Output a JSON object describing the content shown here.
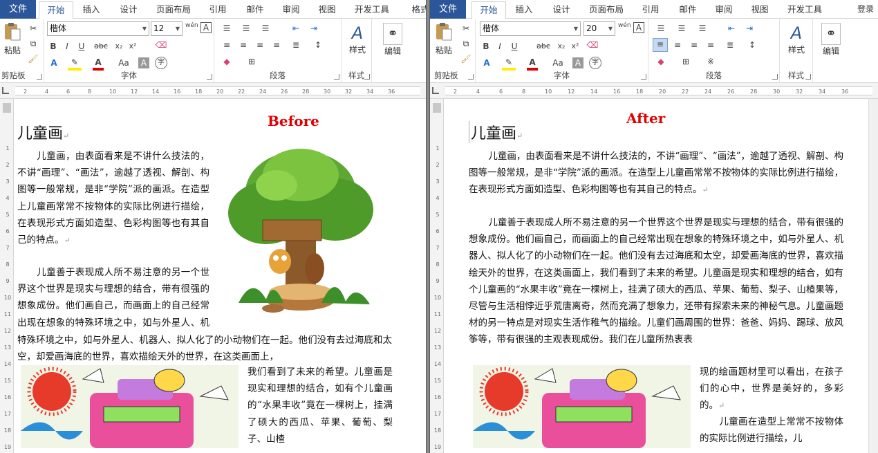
{
  "ribbon": {
    "file_tab": "文件",
    "tabs": [
      "开始",
      "插入",
      "设计",
      "页面布局",
      "引用",
      "邮件",
      "审阅",
      "视图",
      "开发工具",
      "格式"
    ],
    "login": "登录",
    "clipboard": {
      "paste": "粘贴",
      "group": "剪贴板"
    },
    "font": {
      "group": "字体",
      "strike": "abc",
      "sub": "x₂",
      "sup": "x²",
      "wen": "wén",
      "A": "A",
      "case": "Aa",
      "char": "字"
    },
    "paragraph": {
      "group": "段落"
    },
    "styles": {
      "label": "样式",
      "group": "样式"
    },
    "editing": {
      "label": "编辑"
    }
  },
  "left": {
    "font_name": "楷体",
    "font_size": "12",
    "label": "Before",
    "title": "儿童画",
    "p1": "儿童画，由表面看来是不讲什么技法的，不讲“画理”、“画法”，逾越了透视、解剖、构图等一般常规，是非“学院”派的画派。在造型上儿童画常常不按物体的实际比例进行描绘，在表现形式方面如造型、色彩构图等也有其自己的特点。",
    "p2": "儿童善于表现成人所不易注意的另一个世界这个世界是现实与理想的结合，带有很强的想象成份。他们画自己，而画面上的自己经常出现在想象的特殊环境之中，如与外星人、机器人、拟人化了的小动物们在一起。他们没有去过海底和太空，却爱画海底的世界，喜欢描绘天外的世界，在这类画面上，",
    "p3": "我们看到了未来的希望。儿童画是现实和理想的结合，如有个儿童画的“水果丰收”竟在一棵树上，挂满了硕大的西瓜、苹果、葡萄、梨子、山楂"
  },
  "right": {
    "font_name": "楷体",
    "font_size": "20",
    "label": "After",
    "title": "儿童画",
    "p1": "儿童画，由表面看来是不讲什么技法的，不讲“画理”、“画法”，逾越了透视、解剖、构图等一般常规，是非“学院”派的画派。在造型上儿童画常常不按物体的实际比例进行描绘，在表现形式方面如造型、色彩构图等也有其自己的特点。",
    "p2": "儿童善于表现成人所不易注意的另一个世界这个世界是现实与理想的结合，带有很强的想象成份。他们画自己，而画面上的自己经常出现在想象的特殊环境之中，如与外星人、机器人、拟人化了的小动物们在一起。他们没有去过海底和太空，却爱画海底的世界，喜欢描绘天外的世界，在这类画面上，我们看到了未来的希望。儿童画是现实和理想的结合，如有个儿童画的“水果丰收”竟在一棵树上，挂满了硕大的西瓜、苹果、葡萄、梨子、山楂果等，尽管与生活相悖近乎荒唐离奇，然而充满了想象力，还带有探索未来的神秘气息。儿童画题材的另一特点是对现实生活作稚气的描绘。儿童们画周围的世界：爸爸、妈妈、踢球、放风筝等，带有很强的主观表现成份。我们在儿童所热衷表",
    "p2b": "现的绘画题材里可以看出，在孩子们的心中，世界是美好的，多彩的。",
    "p3": "儿童画在造型上常常不按物体的实际比例进行描绘，儿"
  },
  "ruler_ticks": [
    "2",
    "4",
    "6",
    "8",
    "10",
    "12",
    "14",
    "16",
    "18",
    "20",
    "22",
    "24",
    "26",
    "28",
    "30",
    "32",
    "34",
    "36"
  ],
  "vruler_ticks": [
    "1",
    "2",
    "3",
    "4",
    "5",
    "6",
    "7",
    "8",
    "9",
    "10",
    "11",
    "12",
    "13",
    "14",
    "15",
    "16",
    "17",
    "18",
    "19"
  ],
  "colors": {
    "file_tab": "#2b579a",
    "label_red": "#e00000",
    "splitter": "#8a8a8a"
  }
}
